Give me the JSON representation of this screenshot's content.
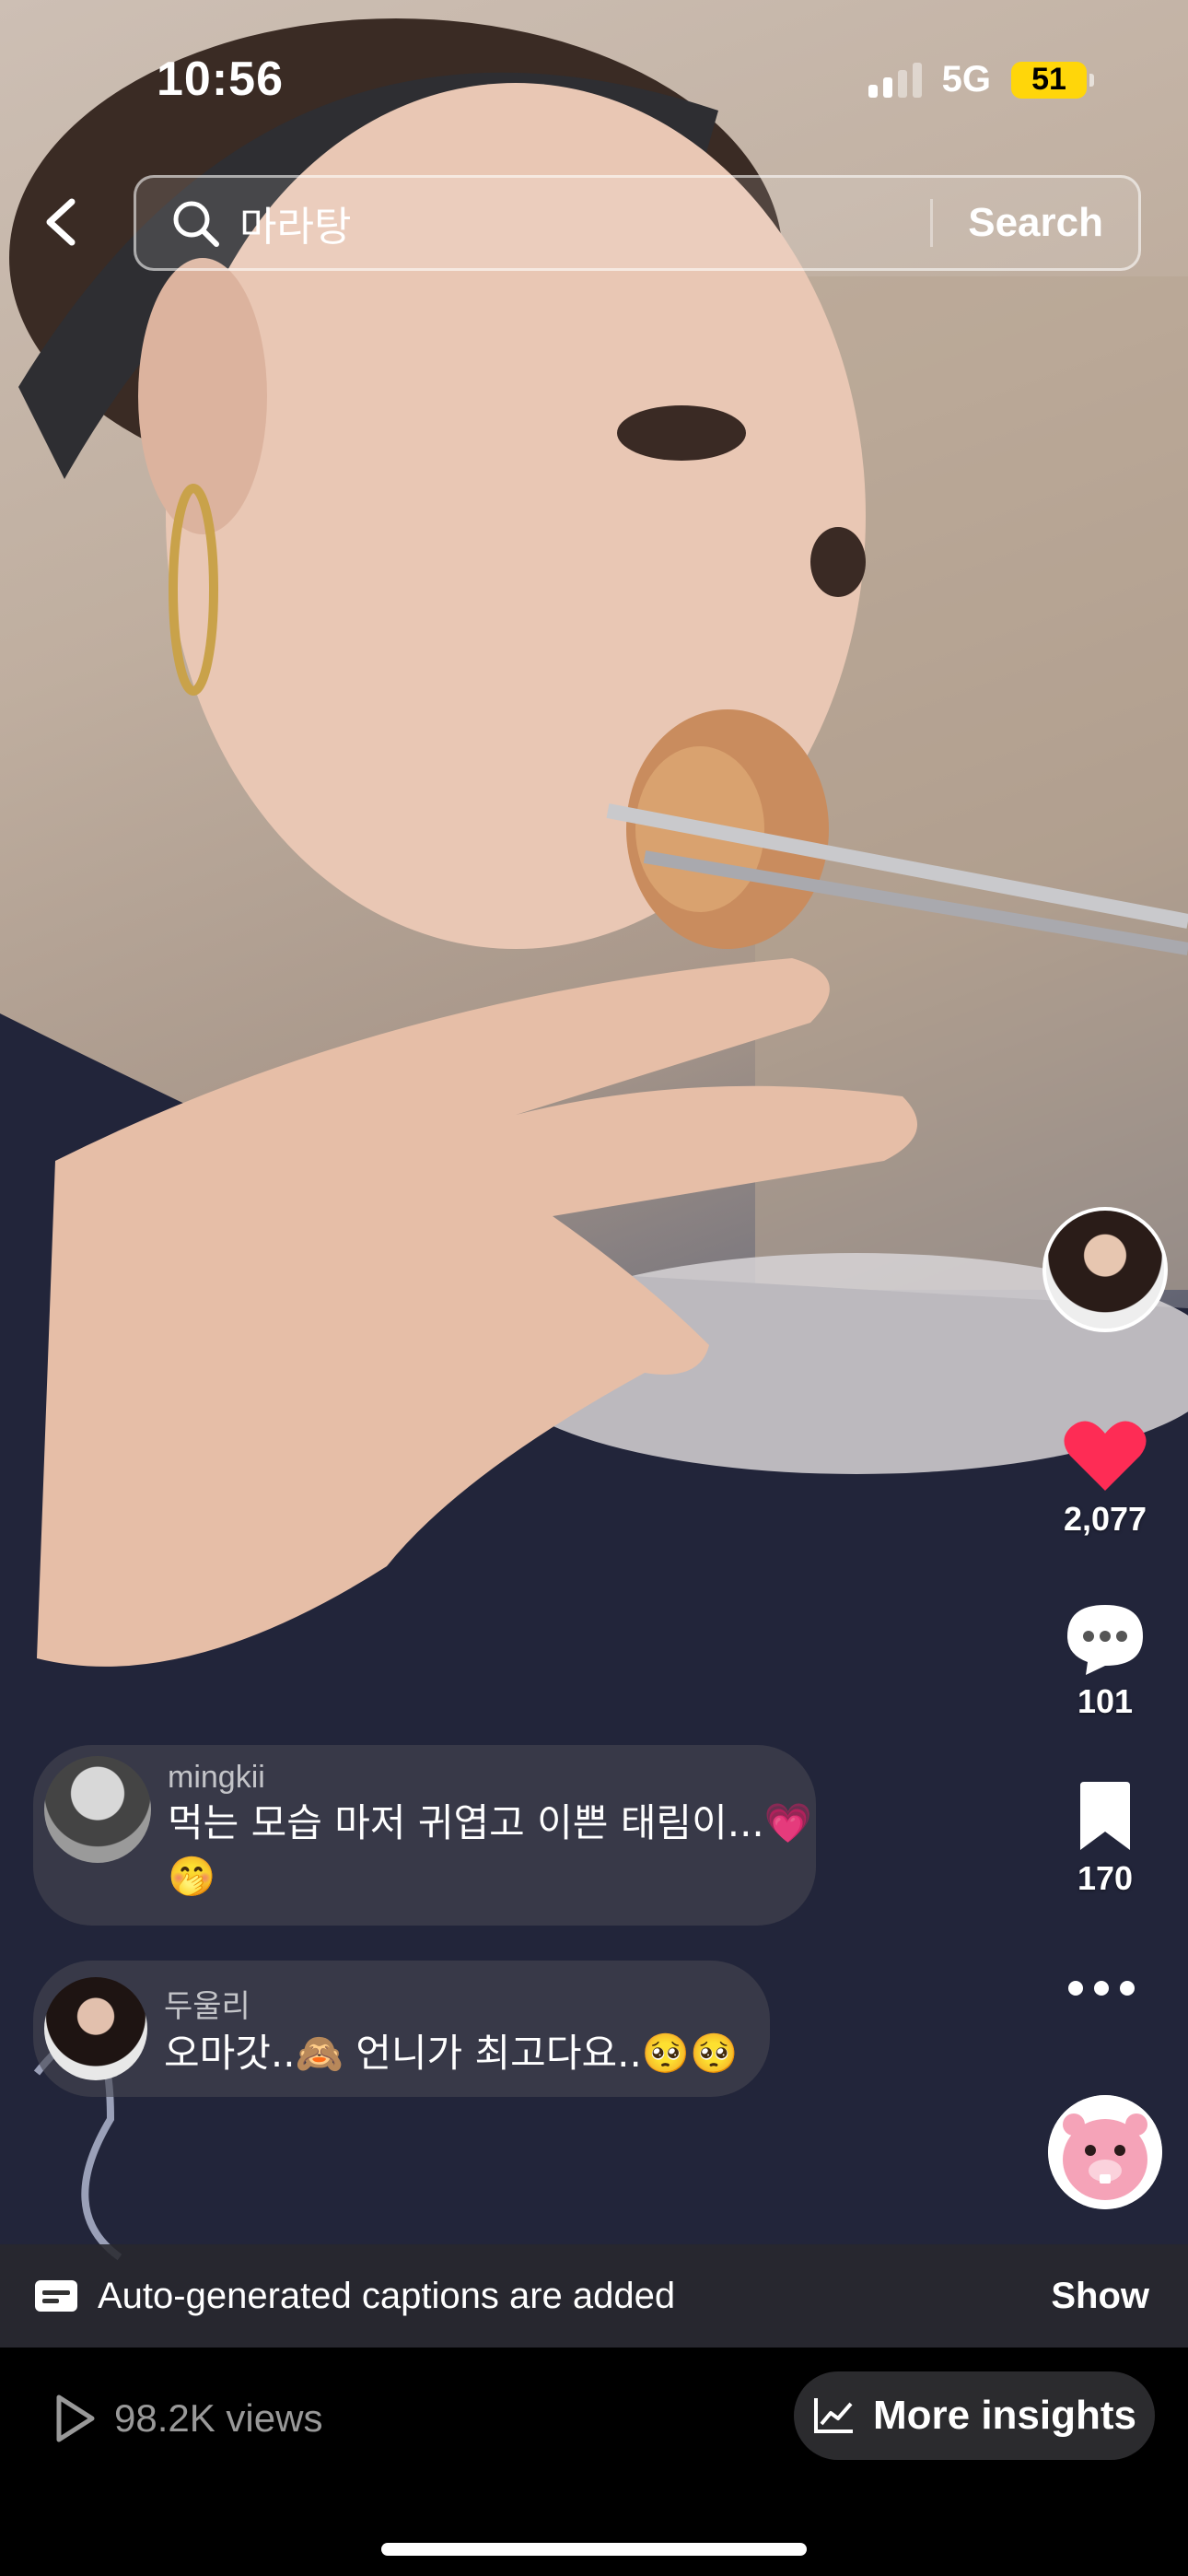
{
  "status_bar": {
    "time": "10:56",
    "network": "5G",
    "battery": "51",
    "battery_color": "#ffd60a"
  },
  "search": {
    "query": "마라탕",
    "button_label": "Search"
  },
  "rail": {
    "likes": "2,077",
    "comments": "101",
    "saves": "170",
    "like_color": "#fe2c55"
  },
  "comments": [
    {
      "user": "mingkii",
      "text_line1": "먹는 모습 마저 귀엽고 이쁜 태림이...💗",
      "text_line2": "🤭"
    },
    {
      "user": "두울리",
      "text_line1": "오마갓..🙈 언니가 최고다요..🥺🥺"
    }
  ],
  "captions": {
    "message": "Auto-generated captions are added",
    "action": "Show"
  },
  "bottom": {
    "views": "98.2K views",
    "insights_label": "More insights"
  },
  "icons": [
    "back-chevron-icon",
    "search-icon",
    "heart-icon",
    "comment-bubble-icon",
    "bookmark-icon",
    "more-dots-icon",
    "captions-icon",
    "play-icon",
    "chart-icon"
  ]
}
